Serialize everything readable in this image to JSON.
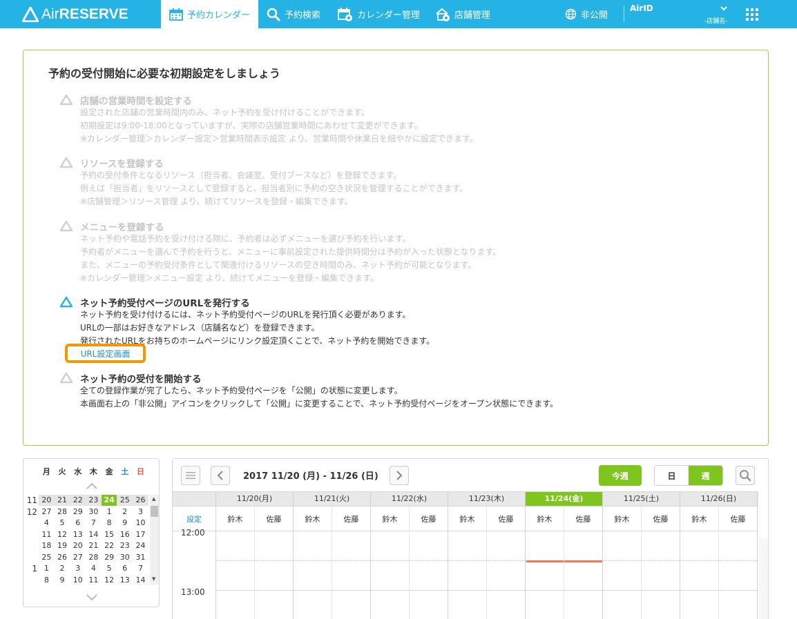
{
  "header": {
    "logo_text_air": "Air",
    "logo_text_reserve": "RESERVE",
    "nav": {
      "calendar": "予約カレンダー",
      "search": "予約検索",
      "calendar_mgmt": "カレンダー管理",
      "shop_mgmt": "店舗管理",
      "public_status": "非公開"
    },
    "airid": "AirID",
    "shop_name": "-店舗名-",
    "accent_color": "#25b3e6"
  },
  "setup": {
    "title": "予約の受付開始に必要な初期設定をしましょう",
    "steps": [
      {
        "title": "店舗の営業時間を設定する",
        "lines": [
          "設定された店舗の営業時間内のみ、ネット予約を受け付けることができます。",
          "初期設定は9:00-18:00となっていますが、実際の店舗営業時間にあわせて変更ができます。",
          "※カレンダー管理＞カレンダー設定＞営業時間表示設定 より、営業時間や休業日を細やかに設定できます。"
        ]
      },
      {
        "title": "リソースを登録する",
        "lines": [
          "予約の受付条件となるリソース（担当者、会議室、受付ブースなど）を登録できます。",
          "例えば「担当者」をリソースとして登録すると、担当者別に予約の空き状況を管理することができます。",
          "※店舗管理＞リソース管理 より、続けてリソースを登録・編集できます。"
        ]
      },
      {
        "title": "メニューを登録する",
        "lines": [
          "ネット予約や電話予約を受け付ける際に、予約者は必ずメニューを選び予約を行います。",
          "予約者がメニューを選んで予約を行うと、メニューに事前設定された提供時間分は予約が入った状態となります。",
          "また、メニューの予約受付条件として関連付けるリソースの空き時間のみ、ネット予約が可能となります。",
          "※カレンダー管理＞メニュー設定 より、続けてメニューを登録・編集できます。"
        ]
      },
      {
        "title": "ネット予約受付ページのURLを発行する",
        "lines": [
          "ネット予約を受け付けるには、ネット予約受付ページのURLを発行頂く必要があります。",
          "URLの一部はお好きなアドレス（店舗名など）を登録できます。",
          "発行されたURLをお持ちのホームページにリンク設定頂くことで、ネット予約を開始できます。"
        ],
        "button": "URL設定画面"
      },
      {
        "title": "ネット予約の受付を開始する",
        "lines": [
          "全ての登録作業が完了したら、ネット予約受付ページを「公開」の状態に変更します。",
          "本画面右上の「非公開」アイコンをクリックして「公開」に変更することで、ネット予約受付ページをオープン状態にできます。"
        ]
      }
    ]
  },
  "mini_calendar": {
    "dows": [
      "月",
      "火",
      "水",
      "木",
      "金",
      "土",
      "日"
    ],
    "rows": [
      {
        "month": "11",
        "days": [
          "20",
          "21",
          "22",
          "23",
          "24",
          "25",
          "26"
        ]
      },
      {
        "month": "12",
        "days": [
          "27",
          "28",
          "29",
          "30",
          "1",
          "2",
          "3"
        ]
      },
      {
        "month": "",
        "days": [
          "4",
          "5",
          "6",
          "7",
          "8",
          "9",
          "10"
        ]
      },
      {
        "month": "",
        "days": [
          "11",
          "12",
          "13",
          "14",
          "15",
          "16",
          "17"
        ]
      },
      {
        "month": "",
        "days": [
          "18",
          "19",
          "20",
          "21",
          "22",
          "23",
          "24"
        ]
      },
      {
        "month": "",
        "days": [
          "25",
          "26",
          "27",
          "28",
          "29",
          "30",
          "31"
        ]
      },
      {
        "month": "1",
        "days": [
          "1",
          "2",
          "3",
          "4",
          "5",
          "6",
          "7"
        ]
      },
      {
        "month": "",
        "days": [
          "8",
          "9",
          "10",
          "11",
          "12",
          "13",
          "14"
        ]
      }
    ],
    "today": "24",
    "saturday_color": "#1a8fd1",
    "sunday_color": "#e8534a"
  },
  "calendar": {
    "date_range": "2017 11/20 (月) - 11/26 (日)",
    "this_week": "今週",
    "view_day": "日",
    "view_week": "週",
    "days": [
      "11/20(月)",
      "11/21(火)",
      "11/22(水)",
      "11/23(木)",
      "11/24(金)",
      "11/25(土)",
      "11/26(日)"
    ],
    "selected_day_index": 4,
    "settings": "設定",
    "resources": [
      "鈴木",
      "佐藤"
    ],
    "times": [
      "12:00",
      "13:00"
    ],
    "highlight_color": "#7ec51e",
    "now_color": "#ef7a5a"
  }
}
